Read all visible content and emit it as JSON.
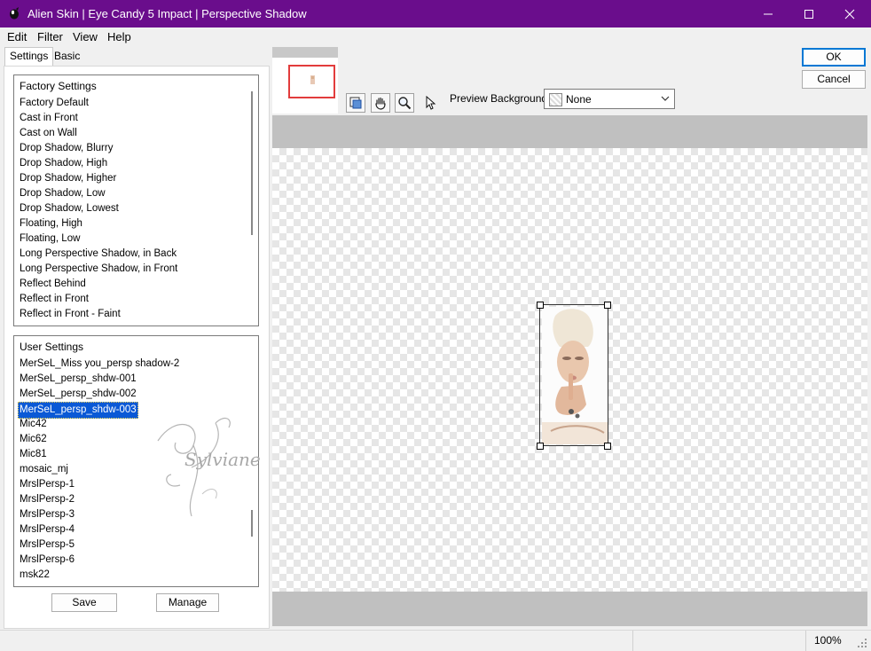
{
  "window": {
    "title": "Alien Skin | Eye Candy 5 Impact | Perspective Shadow",
    "title_bar_color": "#6a0d8c",
    "controls": [
      "minimize-icon",
      "maximize-icon",
      "close-icon"
    ]
  },
  "menu": [
    {
      "label": "Edit"
    },
    {
      "label": "Filter"
    },
    {
      "label": "View"
    },
    {
      "label": "Help"
    }
  ],
  "tabs": [
    {
      "label": "Settings",
      "active": true
    },
    {
      "label": "Basic",
      "active": false
    }
  ],
  "factory_settings": {
    "header": "Factory Settings",
    "items": [
      "Factory Default",
      "Cast in Front",
      "Cast on Wall",
      "Drop Shadow, Blurry",
      "Drop Shadow, High",
      "Drop Shadow, Higher",
      "Drop Shadow, Low",
      "Drop Shadow, Lowest",
      "Floating, High",
      "Floating, Low",
      "Long Perspective Shadow, in Back",
      "Long Perspective Shadow, in Front",
      "Reflect Behind",
      "Reflect in Front",
      "Reflect in Front - Faint"
    ]
  },
  "user_settings": {
    "header": "User Settings",
    "selected_index": 3,
    "items": [
      "MerSeL_Miss you_persp shadow-2",
      "MerSeL_persp_shdw-001",
      "MerSeL_persp_shdw-002",
      "MerSeL_persp_shdw-003",
      "Mic42",
      "Mic62",
      "Mic81",
      "mosaic_mj",
      "MrslPersp-1",
      "MrslPersp-2",
      "MrslPersp-3",
      "MrslPersp-4",
      "MrslPersp-5",
      "MrslPersp-6",
      "msk22"
    ]
  },
  "watermark_text": "Sylviane",
  "buttons": {
    "save": "Save",
    "manage": "Manage",
    "ok": "OK",
    "cancel": "Cancel"
  },
  "toolbar": {
    "tools": [
      "navigator-icon",
      "hand-icon",
      "zoom-icon",
      "arrow-pointer-icon"
    ],
    "preview_background_label": "Preview Background:",
    "preview_background_value": "None"
  },
  "status": {
    "zoom": "100%"
  },
  "colors": {
    "selection": "#0a59d6",
    "accent_button": "#0078d4"
  }
}
